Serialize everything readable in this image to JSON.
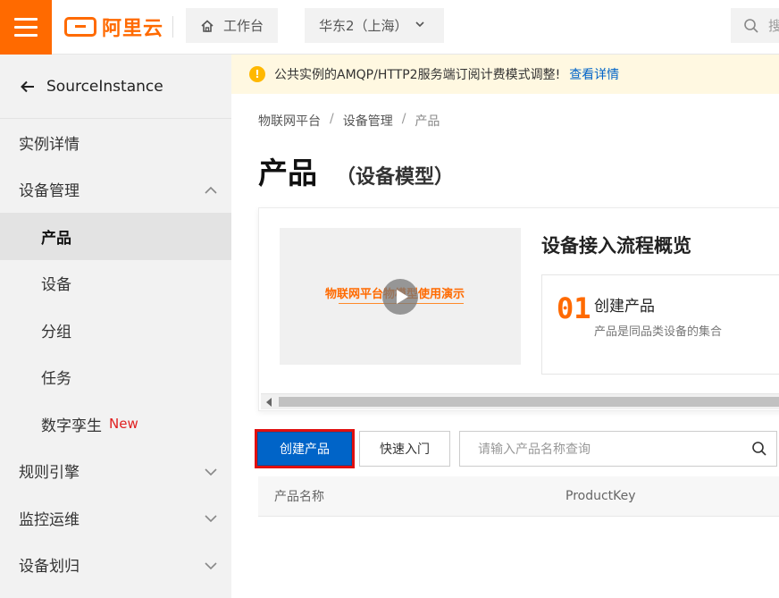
{
  "header": {
    "logo_text": "阿里云",
    "workbench_label": "工作台",
    "region_label": "华东2（上海）",
    "search_placeholder": "搜"
  },
  "sidebar": {
    "back_title": "SourceInstance",
    "items": [
      {
        "label": "实例详情"
      },
      {
        "label": "设备管理"
      },
      {
        "label": "产品"
      },
      {
        "label": "设备"
      },
      {
        "label": "分组"
      },
      {
        "label": "任务"
      },
      {
        "label": "数字孪生",
        "tag": "New"
      },
      {
        "label": "规则引擎"
      },
      {
        "label": "监控运维"
      },
      {
        "label": "设备划归"
      }
    ]
  },
  "notice": {
    "text": "公共实例的AMQP/HTTP2服务端订阅计费模式调整!",
    "link": "查看详情"
  },
  "breadcrumb": [
    "物联网平台",
    "设备管理",
    "产品"
  ],
  "page": {
    "title": "产品",
    "subtitle": "（设备模型）"
  },
  "flow": {
    "video_caption": "物联网平台物模型使用演示",
    "title": "设备接入流程概览",
    "step_number": "01",
    "step_name": "创建产品",
    "step_desc": "产品是同品类设备的集合"
  },
  "actions": {
    "create_label": "创建产品",
    "quickstart_label": "快速入门",
    "search_placeholder": "请输入产品名称查询"
  },
  "table": {
    "columns": [
      "产品名称",
      "ProductKey"
    ]
  },
  "colors": {
    "brand": "#ff6a00",
    "primary": "#0064c8",
    "highlight": "#e01010"
  }
}
